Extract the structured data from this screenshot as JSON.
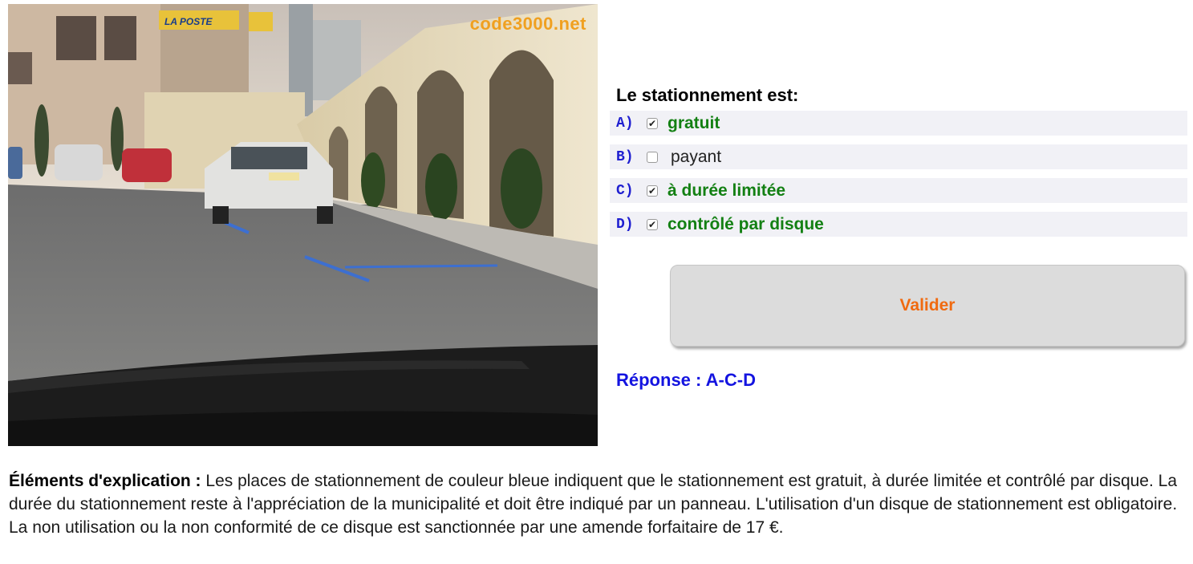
{
  "photo": {
    "watermark": "code3000.net",
    "sign_text": "LA POSTE"
  },
  "question": {
    "text": "Le stationnement est:",
    "answers": [
      {
        "letter": "A)",
        "text": "gratuit",
        "checked": true,
        "correct": true
      },
      {
        "letter": "B)",
        "text": "payant",
        "checked": false,
        "correct": false
      },
      {
        "letter": "C)",
        "text": "à durée limitée",
        "checked": true,
        "correct": true
      },
      {
        "letter": "D)",
        "text": "contrôlé par disque",
        "checked": true,
        "correct": true
      }
    ]
  },
  "button": {
    "label": "Valider"
  },
  "reponse": "Réponse : A-C-D",
  "explanation": {
    "title": "Éléments d'explication :",
    "body": " Les places de stationnement de couleur bleue indiquent que le stationnement est gratuit, à durée limitée et contrôlé par disque. La durée du stationnement reste à l'appréciation de la municipalité et doit être indiqué par un panneau. L'utilisation d'un disque de stationnement est obligatoire. La non utilisation ou la non conformité de ce disque est sanctionnée par une amende forfaitaire de 17 €."
  },
  "colors": {
    "correct": "#138013",
    "letter": "#1f1fd0",
    "button_text": "#f06a10",
    "reponse": "#1414e0",
    "watermark": "#f0a020"
  }
}
